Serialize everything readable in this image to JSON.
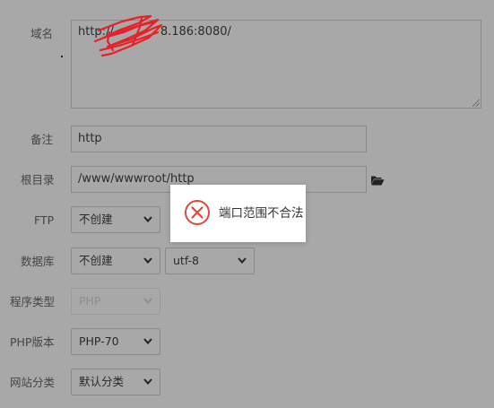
{
  "form": {
    "domain": {
      "label": "域名",
      "value": "http://    8.186:8080/"
    },
    "note": {
      "label": "备注",
      "value": "http"
    },
    "root_dir": {
      "label": "根目录",
      "value": "/www/wwwroot/http"
    },
    "ftp": {
      "label": "FTP",
      "value": "不创建"
    },
    "database": {
      "label": "数据库",
      "value": "不创建",
      "charset": "utf-8"
    },
    "program_type": {
      "label": "程序类型",
      "value": "PHP"
    },
    "php_version": {
      "label": "PHP版本",
      "value": "PHP-70"
    },
    "site_category": {
      "label": "网站分类",
      "value": "默认分类"
    }
  },
  "toast": {
    "message": "端口范围不合法",
    "icon": "error-circle-x-icon",
    "accent_color": "#e2483d"
  },
  "icons": {
    "folder": "folder-open-icon",
    "chevron": "chevron-down-icon"
  },
  "colors": {
    "overlay_background": "#a8a8a8",
    "redaction": "#e8202a"
  }
}
